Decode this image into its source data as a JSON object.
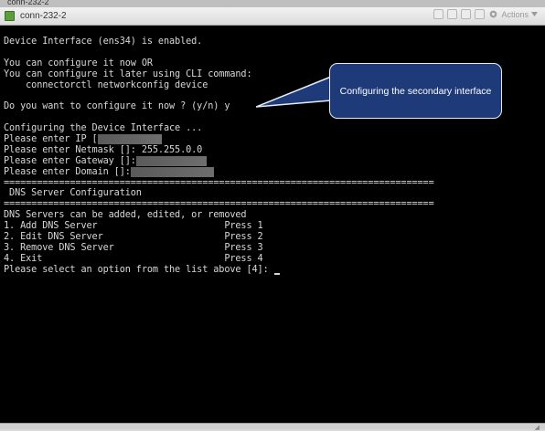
{
  "window": {
    "outer_tab": "conn-232-2",
    "title": "conn-232-2",
    "actions_label": "Actions"
  },
  "terminal": {
    "lines": [
      {
        "text": "Device Interface (ens34) is enabled."
      },
      {
        "text": ""
      },
      {
        "text": "You can configure it now OR"
      },
      {
        "text": "You can configure it later using CLI command:"
      },
      {
        "text": "    connectorctl networkconfig device"
      },
      {
        "text": ""
      },
      {
        "text": "Do you want to configure it now ? (y/n) y"
      },
      {
        "text": ""
      },
      {
        "text": "Configuring the Device Interface ..."
      },
      {
        "text": "Please enter IP [",
        "redact": 10
      },
      {
        "text": "Please enter Netmask []: 255.255.0.0"
      },
      {
        "text": "Please enter Gateway []:",
        "redact": 11
      },
      {
        "text": "Please enter Domain []:",
        "redact": 13
      },
      {
        "text": "=============================================================================="
      },
      {
        "text": " DNS Server Configuration"
      },
      {
        "text": "=============================================================================="
      },
      {
        "text": "DNS Servers can be added, edited, or removed"
      },
      {
        "text": "1. Add DNS Server                       Press 1"
      },
      {
        "text": "2. Edit DNS Server                      Press 2"
      },
      {
        "text": "3. Remove DNS Server                    Press 3"
      },
      {
        "text": "4. Exit                                 Press 4"
      },
      {
        "text": "Please select an option from the list above [4]: ",
        "cursor": true
      }
    ]
  },
  "callout": {
    "text": "Configuring the secondary interface"
  },
  "colors": {
    "terminal_bg": "#000000",
    "terminal_fg": "#d8d8d8",
    "callout_bg": "#1e3a78",
    "callout_border": "#e6ecf7",
    "callout_fg": "#ffffff"
  }
}
